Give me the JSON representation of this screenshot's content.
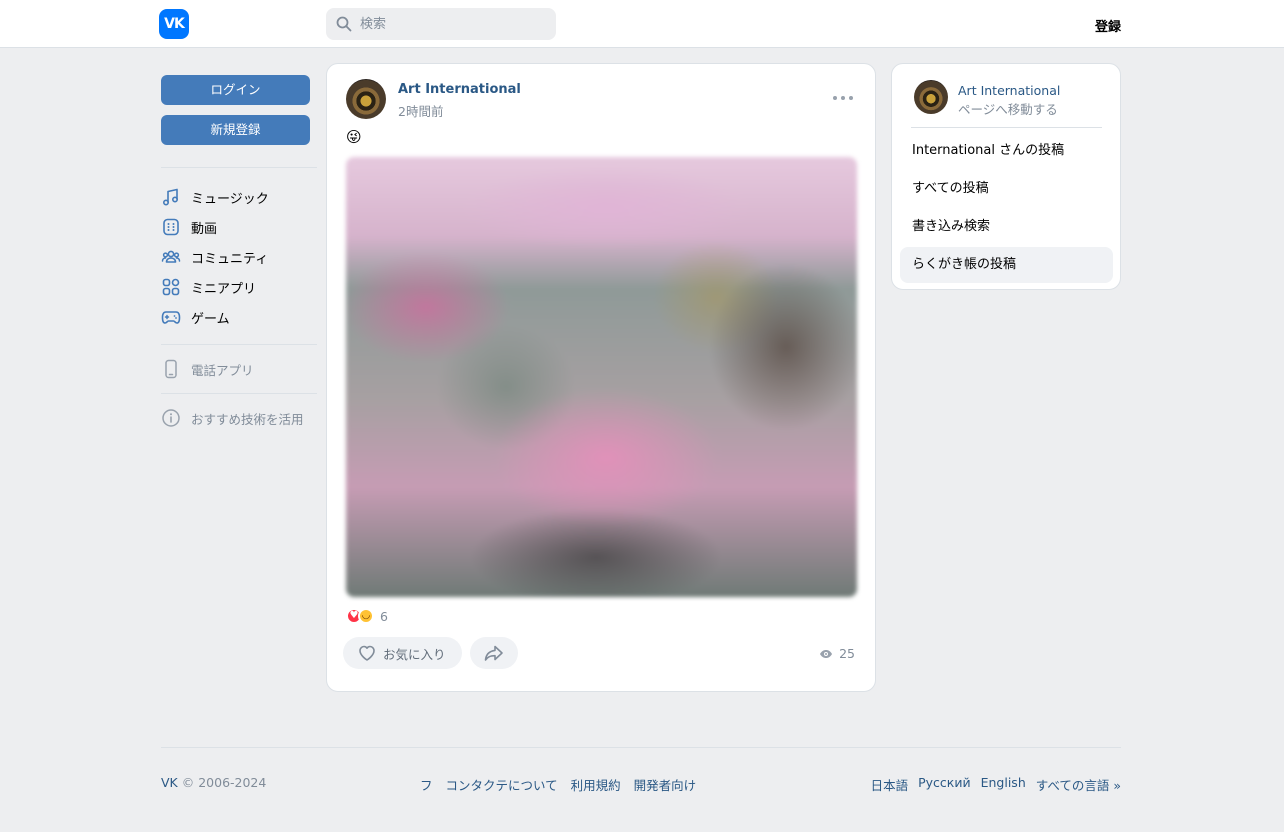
{
  "header": {
    "logo_text": "VK",
    "search_placeholder": "検索",
    "register_label": "登録"
  },
  "sidebar": {
    "login_label": "ログイン",
    "signup_label": "新規登録",
    "items": [
      {
        "label": "ミュージック",
        "icon": "music-icon"
      },
      {
        "label": "動画",
        "icon": "video-icon"
      },
      {
        "label": "コミュニティ",
        "icon": "community-icon"
      },
      {
        "label": "ミニアプリ",
        "icon": "mini-apps-icon"
      },
      {
        "label": "ゲーム",
        "icon": "gamepad-icon"
      }
    ],
    "phone_app_label": "電話アプリ",
    "recommend_label": "おすすめ技術を活用"
  },
  "post": {
    "author": "Art International",
    "time": "2時間前",
    "emoji": "😜",
    "reaction_count": "6",
    "like_label": "お気に入り",
    "views": "25"
  },
  "side_panel": {
    "name": "Art International",
    "subtitle": "ページへ移動する",
    "links": [
      "International さんの投稿",
      "すべての投稿",
      "書き込み検索",
      "らくがき帳の投稿"
    ]
  },
  "footer": {
    "copyright_brand": "VK",
    "copyright_years": "© 2006-2024",
    "mid_links": [
      "フ",
      "コンタクテについて",
      "利用規約",
      "開発者向け"
    ],
    "lang_links": [
      "日本語",
      "Русский",
      "English",
      "すべての言語 »"
    ]
  },
  "colors": {
    "brand": "#0077ff",
    "button_blue": "#447bba",
    "link": "#2a5885",
    "muted": "#818c99",
    "background": "#edeef0"
  }
}
